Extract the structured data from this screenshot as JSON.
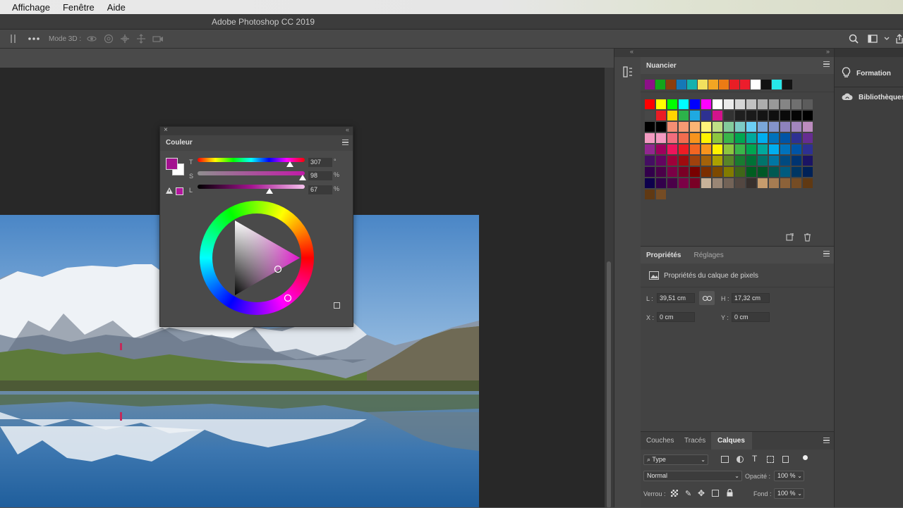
{
  "menubar": {
    "items": [
      "Affichage",
      "Fenêtre",
      "Aide"
    ]
  },
  "window": {
    "title": "Adobe Photoshop CC 2019"
  },
  "optionsbar": {
    "mode3d_label": "Mode 3D :"
  },
  "color_panel": {
    "tab": "Couleur",
    "hue": {
      "label": "T",
      "value": "307",
      "unit": "°",
      "fraction": 0.86
    },
    "sat": {
      "label": "S",
      "value": "98",
      "unit": "%",
      "fraction": 0.98
    },
    "lum": {
      "label": "L",
      "value": "67",
      "unit": "%",
      "fraction": 0.67
    },
    "foreground": "#a3128f",
    "background": "#ffffff",
    "gamut_swatch": "#b3169d"
  },
  "swatches_panel": {
    "tab": "Nuancier",
    "recent": [
      "#8d1087",
      "#13a51a",
      "#8b3d0e",
      "#1578b7",
      "#13b1ad",
      "#f2e05e",
      "#f2a623",
      "#ec7b14",
      "#e81e25",
      "#ec1d2c",
      "#ffffff",
      "#111111",
      "#27e7e9",
      "#141414"
    ],
    "grid": [
      [
        "#ff0000",
        "#ffff00",
        "#00ff00",
        "#00ffff",
        "#0000ff",
        "#ff00ff",
        "#ffffff",
        "#ebebeb",
        "#d6d6d6",
        "#c2c2c2",
        "#adadad",
        "#999999",
        "#858585",
        "#707070",
        "#5c5c5c"
      ],
      [
        "#474747",
        "#eb1c24",
        "#ffd500",
        "#2cb34a",
        "#1fa9e1",
        "#2e3192",
        "#d3138c",
        "#333333",
        "#1f1f1f",
        "#1a1a1a",
        "#141414",
        "#0f0f0f",
        "#0a0a0a",
        "#050505",
        "#000000"
      ],
      [
        "#000000",
        "#000000",
        "#f58e73",
        "#f79a73",
        "#fbb574",
        "#fff47a",
        "#c0df85",
        "#83cb9b",
        "#7ccbc5",
        "#6ccff6",
        "#7aa7d9",
        "#8494cb",
        "#8e82bd",
        "#a286bd",
        "#bc8cbf"
      ],
      [
        "#f29bc1",
        "#f49ac1",
        "#f26d7d",
        "#f26c4f",
        "#f7941d",
        "#fff200",
        "#8dc63f",
        "#39b54a",
        "#00a651",
        "#00a99d",
        "#00aeef",
        "#0072bc",
        "#0054a6",
        "#2e3192",
        "#662d91"
      ],
      [
        "#92278f",
        "#9e005d",
        "#ed145b",
        "#ed1c24",
        "#f26522",
        "#f7941d",
        "#fff200",
        "#8dc63f",
        "#39b54a",
        "#00a651",
        "#00a99d",
        "#00aeef",
        "#0072bc",
        "#0054a6",
        "#2e3192"
      ],
      [
        "#440e62",
        "#630460",
        "#9e0039",
        "#9e0b0f",
        "#a0410d",
        "#a3620a",
        "#aba000",
        "#598527",
        "#197b30",
        "#007236",
        "#00746b",
        "#0076a3",
        "#004a80",
        "#003471",
        "#1b1464"
      ],
      [
        "#32004b",
        "#4b0049",
        "#7b0046",
        "#7a0026",
        "#790000",
        "#7b2e00",
        "#7d4900",
        "#827b00",
        "#406618",
        "#005e20",
        "#005826",
        "#005952",
        "#005b7f",
        "#003663",
        "#002157"
      ],
      [
        "#0d004c",
        "#32004b",
        "#4b0049",
        "#7b0046",
        "#7a0026",
        "#c7b299",
        "#998675",
        "#736357",
        "#534741",
        "#37302d",
        "#c69c6d",
        "#a67c52",
        "#8c6239",
        "#754c24",
        "#603913"
      ],
      [
        "#603913",
        "#754c24"
      ]
    ]
  },
  "properties_panel": {
    "tabs": [
      "Propriétés",
      "Réglages"
    ],
    "heading": "Propriétés du calque de pixels",
    "width_label": "L :",
    "width_value": "39,51 cm",
    "height_label": "H :",
    "height_value": "17,32 cm",
    "x_label": "X :",
    "x_value": "0 cm",
    "y_label": "Y :",
    "y_value": "0 cm"
  },
  "layers_panel": {
    "tabs": [
      "Couches",
      "Tracés",
      "Calques"
    ],
    "filter_label": "Type",
    "blend_mode": "Normal",
    "opacity_label": "Opacité :",
    "opacity_value": "100 %",
    "lock_label": "Verrou :",
    "fill_label": "Fond :",
    "fill_value": "100 %"
  },
  "right_dock": {
    "items": [
      "Formation",
      "Bibliothèques"
    ]
  },
  "icons": [
    "grip-icon",
    "more-icon",
    "orbit-3d-icon",
    "roll-3d-icon",
    "pan-3d-icon",
    "slide-3d-icon",
    "camera-3d-icon",
    "search-icon",
    "workspace-icon",
    "share-icon",
    "lightbulb-icon",
    "libraries-icon",
    "collapse-icon",
    "close-icon",
    "panel-menu-icon",
    "new-swatch-icon",
    "trash-icon",
    "pixel-layer-icon",
    "link-icon",
    "gamut-warning-icon",
    "cube-icon",
    "lock-icon"
  ]
}
